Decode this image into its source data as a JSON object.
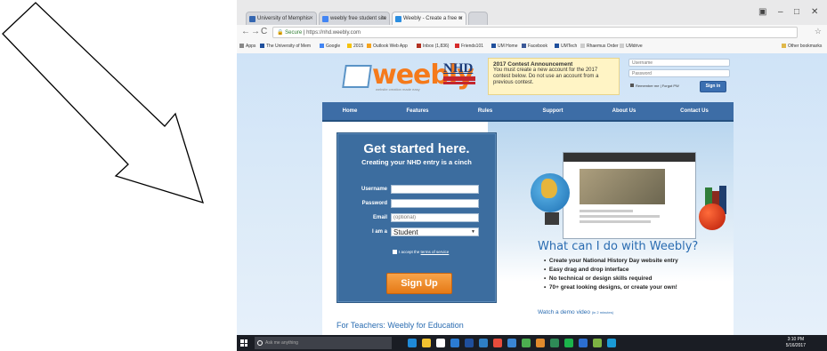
{
  "annotation": {
    "marker": "②"
  },
  "browser": {
    "tabs": [
      {
        "label": "University of Memphis"
      },
      {
        "label": "weebly free student site"
      },
      {
        "label": "Weebly - Create a free w"
      }
    ],
    "address": {
      "secure_label": "Secure",
      "url": "https://nhd.weebly.com"
    },
    "bookmarks": [
      "Apps",
      "The University of Mem",
      "Google",
      "2015",
      "Outlook Web App",
      "Inbox (1,836)",
      "Friends101",
      "UM Home",
      "Facebook",
      "UMTech",
      "Rhaemus Order",
      "UMdrive",
      "Other bookmarks"
    ]
  },
  "site": {
    "logo": "weebly",
    "logo_tagline": "website creation made easy",
    "nhd": "NHD",
    "contest": {
      "title": "2017 Contest Announcement",
      "body": "You must create a new account for the 2017 contest below. Do not use an account from a previous contest."
    },
    "login": {
      "username_placeholder": "Username",
      "password_placeholder": "Password",
      "remember": "Remember me | Forgot PW",
      "signin": "Sign in"
    },
    "nav": [
      "Home",
      "Features",
      "Rules",
      "Support",
      "About Us",
      "Contact Us"
    ],
    "signup": {
      "title": "Get started here.",
      "subtitle": "Creating your NHD entry is a cinch",
      "username_label": "Username",
      "password_label": "Password",
      "email_label": "Email",
      "email_placeholder": "(optional)",
      "iam_label": "I am a",
      "iam_value": "Student",
      "terms_prefix": "I accept the",
      "terms_link": "terms of service",
      "button": "Sign Up"
    },
    "what": {
      "title": "What can I do with Weebly?",
      "bullets": [
        "Create your National History Day website entry",
        "Easy drag and drop interface",
        "No technical or design skills required",
        "70+ great looking designs, or create your own!"
      ],
      "demo": "Watch a demo video",
      "demo_small": "(in 2 minutes)"
    },
    "teachers": "For Teachers: Weebly for Education"
  },
  "taskbar": {
    "search_placeholder": "Ask me anything",
    "time": "3:10 PM",
    "date": "5/16/2017"
  }
}
